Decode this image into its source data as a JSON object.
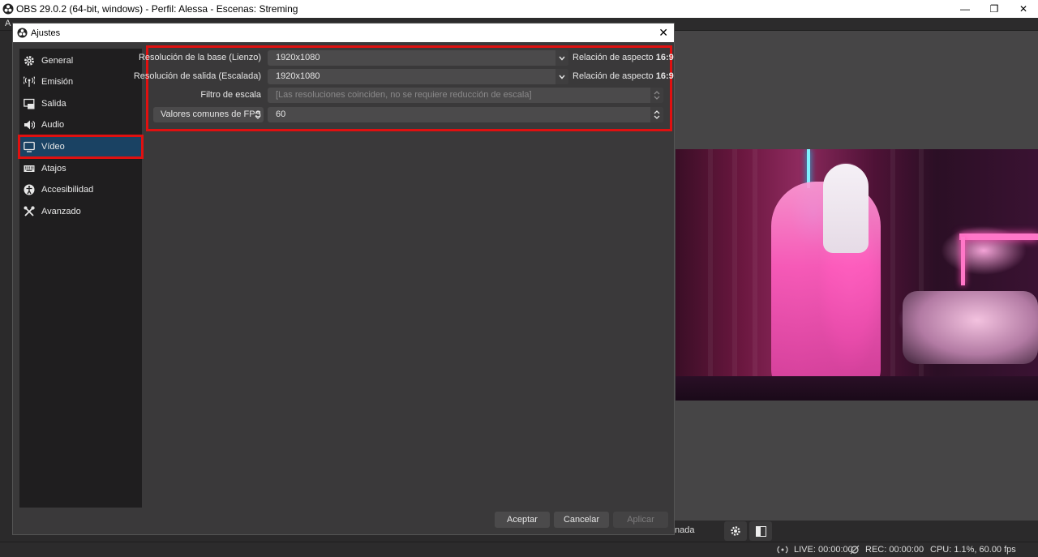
{
  "main_window": {
    "title": "OBS 29.0.2 (64-bit, windows) - Perfil: Alessa - Escenas: Streming",
    "controls": {
      "minimize": "—",
      "maximize": "❐",
      "close": "✕"
    },
    "menu_partial": "A"
  },
  "dialog": {
    "title": "Ajustes",
    "close": "✕"
  },
  "sidebar": {
    "items": [
      {
        "label": "General",
        "icon": "gear-icon"
      },
      {
        "label": "Emisión",
        "icon": "broadcast-icon"
      },
      {
        "label": "Salida",
        "icon": "output-icon"
      },
      {
        "label": "Audio",
        "icon": "speaker-icon"
      },
      {
        "label": "Vídeo",
        "icon": "monitor-icon",
        "selected": true
      },
      {
        "label": "Atajos",
        "icon": "keyboard-icon"
      },
      {
        "label": "Accesibilidad",
        "icon": "accessibility-icon"
      },
      {
        "label": "Avanzado",
        "icon": "tools-icon"
      }
    ]
  },
  "video": {
    "base_resolution": {
      "label": "Resolución de la base (Lienzo)",
      "value": "1920x1080",
      "aspect_label": "Relación de aspecto",
      "aspect_value": "16:9"
    },
    "output_resolution": {
      "label": "Resolución de salida (Escalada)",
      "value": "1920x1080",
      "aspect_label": "Relación de aspecto",
      "aspect_value": "16:9"
    },
    "scale_filter": {
      "label": "Filtro de escala",
      "value": "[Las resoluciones coinciden, no se requiere reducción de escala]"
    },
    "fps": {
      "mode": "Valores comunes de FPS",
      "value": "60"
    }
  },
  "buttons": {
    "accept": "Aceptar",
    "cancel": "Cancelar",
    "apply": "Aplicar"
  },
  "background": {
    "controls_text": "nada"
  },
  "statusbar": {
    "live": "LIVE: 00:00:00",
    "rec": "REC: 00:00:00",
    "cpu": "CPU: 1.1%, 60.00 fps"
  },
  "colors": {
    "highlight": "#e01010",
    "selected_item": "#1a4263",
    "dialog_bg": "#3a393a",
    "sidebar_bg": "#1f1e1f"
  }
}
